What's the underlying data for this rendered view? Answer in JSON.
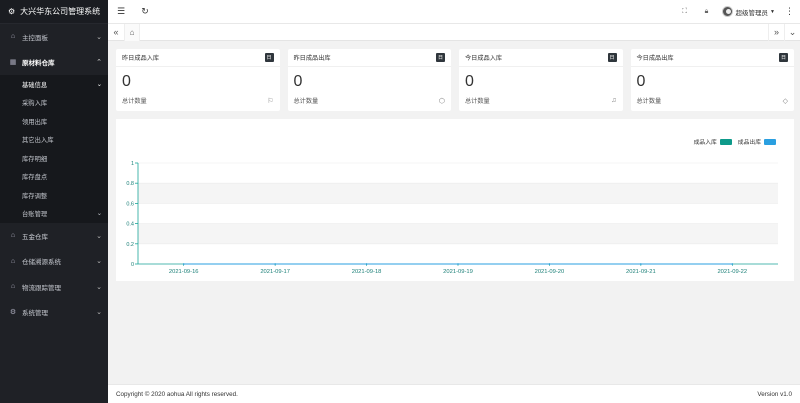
{
  "app": {
    "title": "大兴华东公司管理系统"
  },
  "sidebar": {
    "items": [
      {
        "label": "主控面板",
        "icon": "home-icon"
      },
      {
        "label": "原材料仓库",
        "icon": "grid-icon",
        "active": true,
        "children": [
          {
            "label": "基础信息",
            "expandable": true
          },
          {
            "label": "采购入库"
          },
          {
            "label": "领用出库"
          },
          {
            "label": "其它出入库"
          },
          {
            "label": "库存明细"
          },
          {
            "label": "库存盘点"
          },
          {
            "label": "库存调整"
          },
          {
            "label": "台账管理",
            "expandable": true
          }
        ]
      },
      {
        "label": "五金仓库",
        "icon": "home-icon"
      },
      {
        "label": "仓储溯源系统",
        "icon": "home-icon"
      },
      {
        "label": "物流跟踪管理",
        "icon": "home-icon"
      },
      {
        "label": "系统管理",
        "icon": "gear-icon"
      }
    ]
  },
  "header": {
    "user": "超级管理员"
  },
  "cards": [
    {
      "title": "昨日成品入库",
      "badge": "日",
      "value": "0",
      "footer": "总计数量",
      "icon": "flag-icon"
    },
    {
      "title": "昨日成品出库",
      "badge": "日",
      "value": "0",
      "footer": "总计数量",
      "icon": "tag-icon"
    },
    {
      "title": "今日成品入库",
      "badge": "日",
      "value": "0",
      "footer": "总计数量",
      "icon": "bell-icon"
    },
    {
      "title": "今日成品出库",
      "badge": "日",
      "value": "0",
      "footer": "总计数量",
      "icon": "diamond-icon"
    }
  ],
  "chart_data": {
    "type": "line",
    "categories": [
      "2021-09-16",
      "2021-09-17",
      "2021-09-18",
      "2021-09-19",
      "2021-09-20",
      "2021-09-21",
      "2021-09-22"
    ],
    "series": [
      {
        "name": "成品入库",
        "values": [
          0,
          0,
          0,
          0,
          0,
          0,
          0
        ],
        "color": "#0e9a8a"
      },
      {
        "name": "成品出库",
        "values": [
          0,
          0,
          0,
          0,
          0,
          0,
          0
        ],
        "color": "#2a9fe0"
      }
    ],
    "yticks": [
      "0",
      "0.2",
      "0.4",
      "0.6",
      "0.8",
      "1"
    ],
    "ylim": [
      0,
      1
    ],
    "axis_color": "#1aa59a",
    "legend": "top-right"
  },
  "footer": {
    "copyright": "Copyright © 2020 aohua All rights reserved.",
    "version": "Version v1.0"
  }
}
